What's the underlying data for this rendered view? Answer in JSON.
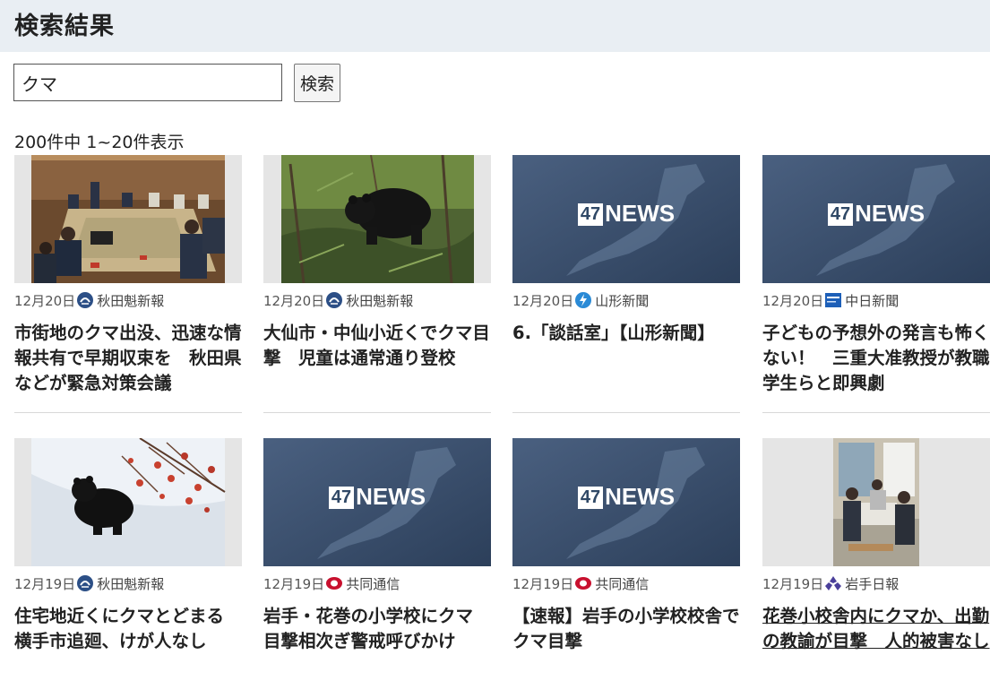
{
  "header": {
    "title": "検索結果"
  },
  "search": {
    "value": "クマ",
    "button_label": "検索"
  },
  "result_count": "200件中 1~20件表示",
  "colors": {
    "header_bg": "#e9eef3",
    "news47_bg": "#3e5470"
  },
  "cards": [
    {
      "date": "12月20日",
      "source": "秋田魁新報",
      "title": "市街地のクマ出没、迅速な情報共有で早期収束を　秋田県などが緊急対策会議",
      "thumb": "meeting-photo"
    },
    {
      "date": "12月20日",
      "source": "秋田魁新報",
      "title": "大仙市・中仙小近くでクマ目撃　児童は通常通り登校",
      "thumb": "bear-forest-photo"
    },
    {
      "date": "12月20日",
      "source": "山形新聞",
      "title": "6.「談話室」【山形新聞】",
      "thumb": "47news-placeholder",
      "news_label": "NEWS",
      "news_badge": "47"
    },
    {
      "date": "12月20日",
      "source": "中日新聞",
      "title": "子どもの予想外の発言も怖くない！　三重大准教授が教職学生らと即興劇",
      "thumb": "47news-placeholder",
      "news_label": "NEWS",
      "news_badge": "47"
    },
    {
      "date": "12月19日",
      "source": "秋田魁新報",
      "title": "住宅地近くにクマとどまる　横手市追廻、けが人なし",
      "thumb": "bear-snow-photo"
    },
    {
      "date": "12月19日",
      "source": "共同通信",
      "title": "岩手・花巻の小学校にクマ　目撃相次ぎ警戒呼びかけ",
      "thumb": "47news-placeholder",
      "news_label": "NEWS",
      "news_badge": "47"
    },
    {
      "date": "12月19日",
      "source": "共同通信",
      "title": "【速報】岩手の小学校校舎でクマ目撃",
      "thumb": "47news-placeholder",
      "news_label": "NEWS",
      "news_badge": "47"
    },
    {
      "date": "12月19日",
      "source": "岩手日報",
      "title": "花巻小校舎内にクマか、出勤の教諭が目撃　人的被害なし",
      "thumb": "school-office-photo"
    }
  ]
}
